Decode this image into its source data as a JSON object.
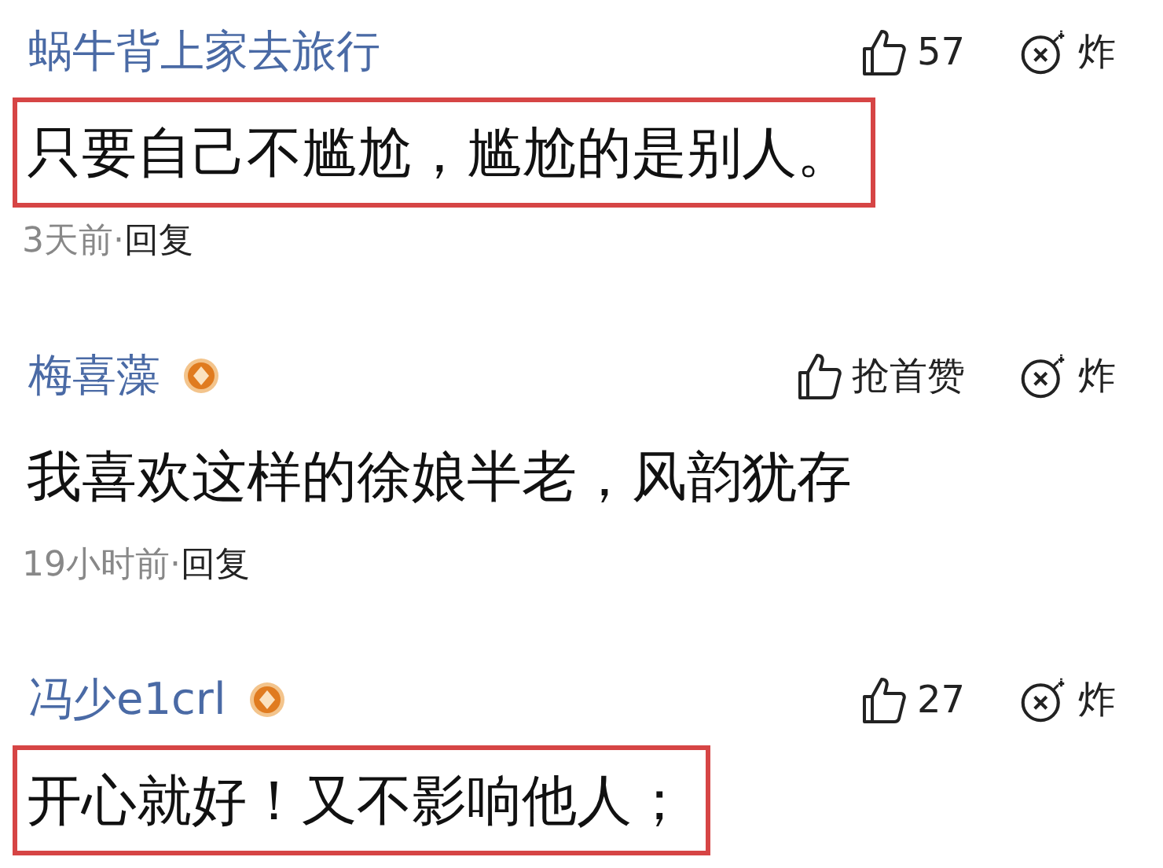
{
  "comments": [
    {
      "author": "蜗牛背上家去旅行",
      "badge": false,
      "likes": "57",
      "bomb": "炸",
      "text": "只要自己不尴尬，尴尬的是别人。",
      "highlighted": true,
      "time": "3天前·",
      "reply": "回复"
    },
    {
      "author": "梅喜藻",
      "badge": true,
      "likes": "抢首赞",
      "bomb": "炸",
      "text": "我喜欢这样的徐娘半老，风韵犹存",
      "highlighted": false,
      "time": "19小时前·",
      "reply": "回复"
    },
    {
      "author": "冯少e1crl",
      "badge": true,
      "likes": "27",
      "bomb": "炸",
      "text": "开心就好！又不影响他人；",
      "highlighted": true
    }
  ]
}
